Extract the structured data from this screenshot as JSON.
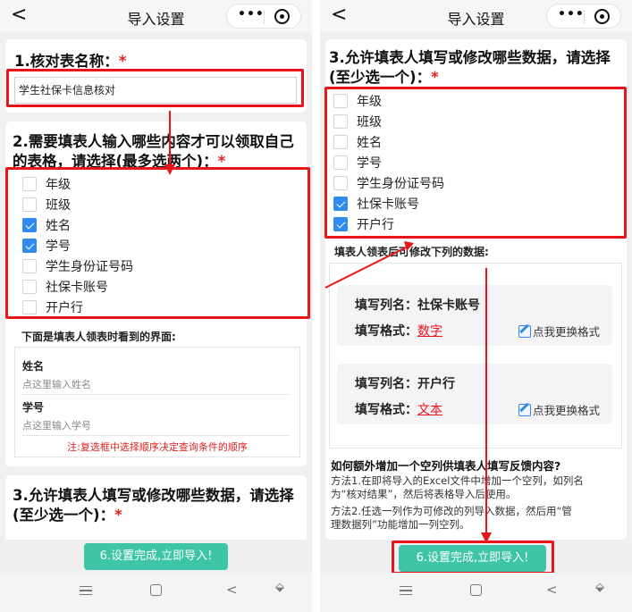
{
  "header": {
    "title": "导入设置",
    "back_glyph": "<",
    "menu_glyph": "•••"
  },
  "q1": {
    "title": "1.核对表名称：",
    "required": "*",
    "value": "学生社保卡信息核对"
  },
  "q2": {
    "title_line1": "2.需要填表人输入哪些内容才可以领取自己",
    "title_line2": "的表格，请选择(最多选两个)：",
    "required": "*",
    "options": [
      {
        "label": "年级",
        "checked": false
      },
      {
        "label": "班级",
        "checked": false
      },
      {
        "label": "姓名",
        "checked": true
      },
      {
        "label": "学号",
        "checked": true
      },
      {
        "label": "学生身份证号码",
        "checked": false
      },
      {
        "label": "社保卡账号",
        "checked": false
      },
      {
        "label": "开户行",
        "checked": false
      }
    ],
    "preview_heading": "下面是填表人领表时看到的界面:",
    "preview_fields": [
      {
        "label": "姓名",
        "placeholder": "点这里输入姓名"
      },
      {
        "label": "学号",
        "placeholder": "点这里输入学号"
      }
    ],
    "note": "注:复选框中选择顺序决定查询条件的顺序"
  },
  "q3": {
    "title_line1": "3.允许填表人填写或修改哪些数据，请选择",
    "title_line2": "(至少选一个)：",
    "required": "*",
    "first_option_partial": "年级",
    "options": [
      {
        "label": "年级",
        "checked": false
      },
      {
        "label": "班级",
        "checked": false
      },
      {
        "label": "姓名",
        "checked": false
      },
      {
        "label": "学号",
        "checked": false
      },
      {
        "label": "学生身份证号码",
        "checked": false
      },
      {
        "label": "社保卡账号",
        "checked": true
      },
      {
        "label": "开户行",
        "checked": true
      }
    ],
    "editable_heading": "填表人领表后可修改下列的数据:",
    "columns": [
      {
        "name_label": "填写列名：",
        "name": "社保卡账号",
        "format_label": "填写格式：",
        "format": "数字",
        "change": "点我更换格式"
      },
      {
        "name_label": "填写列名：",
        "name": "开户行",
        "format_label": "填写格式：",
        "format": "文本",
        "change": "点我更换格式"
      }
    ]
  },
  "help": {
    "heading": "如何额外增加一个空列供填表人填写反馈内容?",
    "method1_line1": "方法1.在即将导入的Excel文件中增加一个空列，如列名",
    "method1_line2": "为“核对结果”，然后将表格导入后使用。",
    "method2_line1": "方法2.任选一列作为可修改的列导入数据，然后用“管",
    "method2_line2": "理数据列”功能增加一列空列。"
  },
  "submit_label": "6.设置完成,立即导入!",
  "nav": {
    "back_glyph": "<",
    "down_glyph": "⬙"
  },
  "colors": {
    "accent": "#3ec4a6",
    "highlight": "#e8151b",
    "checkbox": "#2f8bf0"
  }
}
